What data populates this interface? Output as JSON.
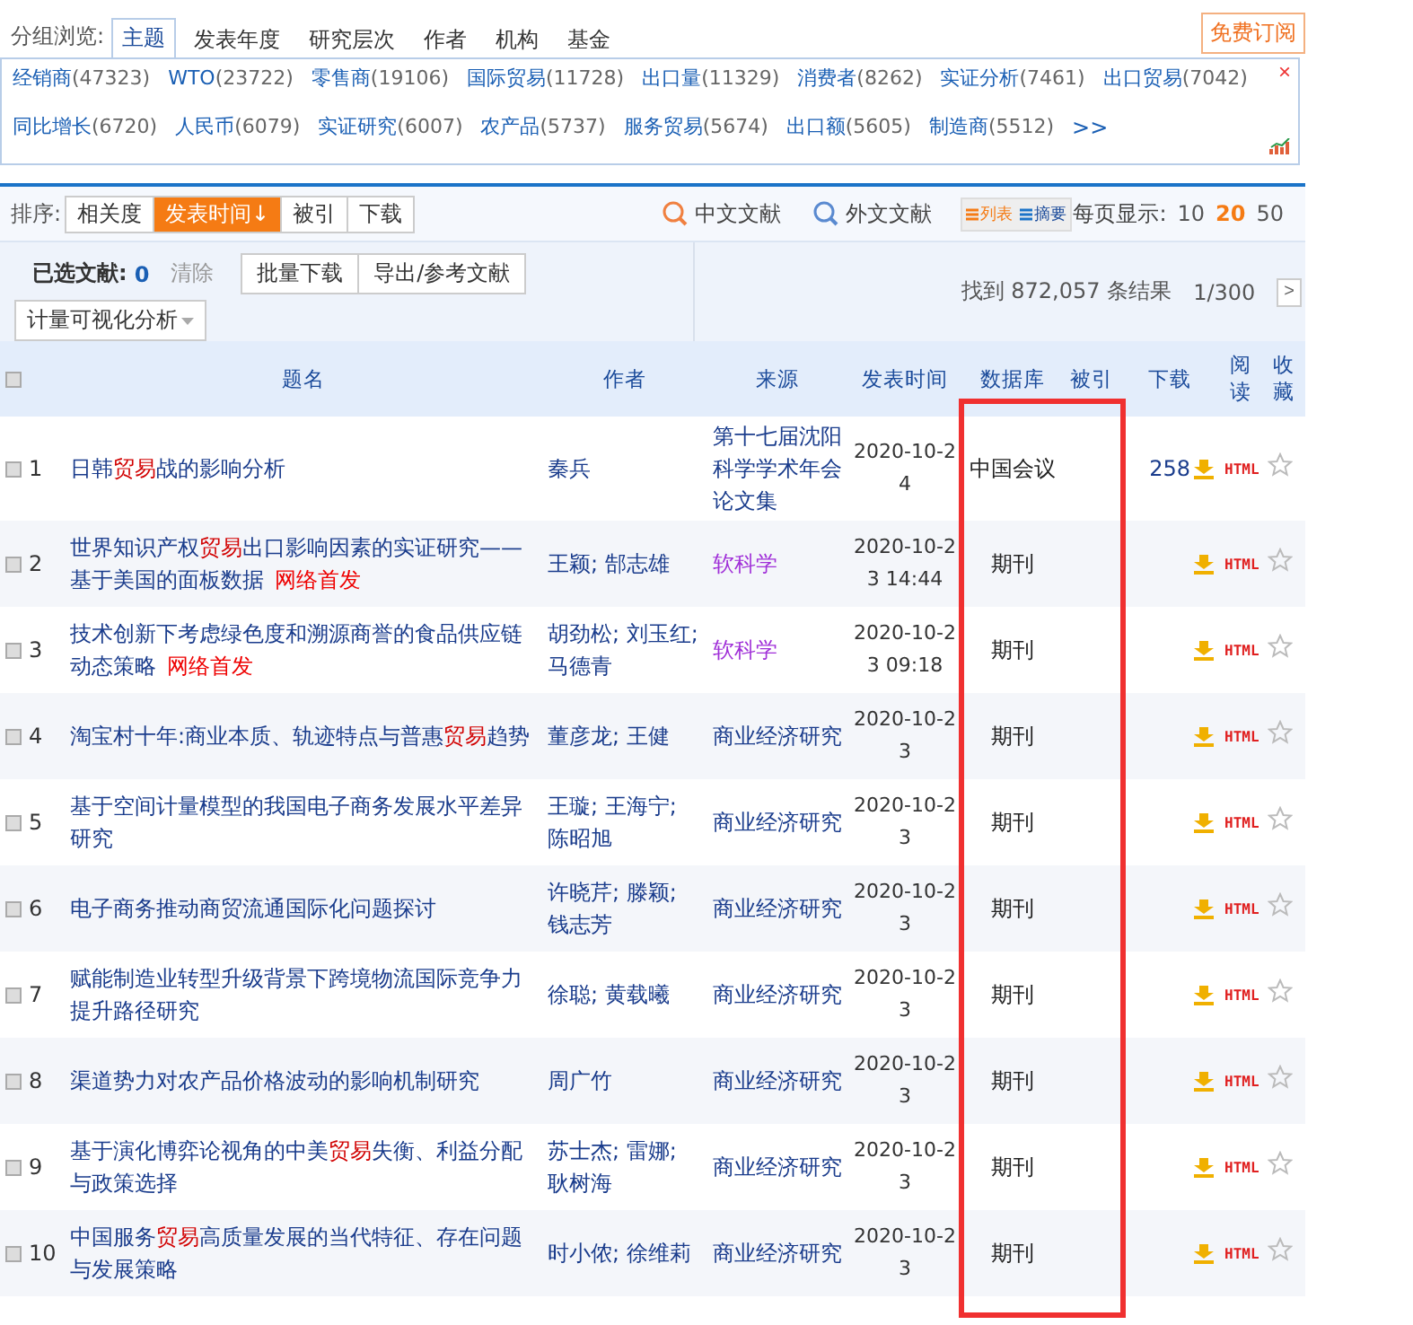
{
  "group_browse": {
    "label": "分组浏览:",
    "tabs": [
      {
        "label": "主题",
        "selected": true
      },
      {
        "label": "发表年度",
        "selected": false
      },
      {
        "label": "研究层次",
        "selected": false
      },
      {
        "label": "作者",
        "selected": false
      },
      {
        "label": "机构",
        "selected": false
      },
      {
        "label": "基金",
        "selected": false
      }
    ],
    "subscribe": "免费订阅",
    "close": "×",
    "keywords": [
      {
        "term": "经销商",
        "count": "(47323)"
      },
      {
        "term": "WTO",
        "count": "(23722)"
      },
      {
        "term": "零售商",
        "count": "(19106)"
      },
      {
        "term": "国际贸易",
        "count": "(11728)"
      },
      {
        "term": "出口量",
        "count": "(11329)"
      },
      {
        "term": "消费者",
        "count": "(8262)"
      },
      {
        "term": "实证分析",
        "count": "(7461)"
      },
      {
        "term": "出口贸易",
        "count": "(7042)"
      },
      {
        "term": "同比增长",
        "count": "(6720)"
      },
      {
        "term": "人民币",
        "count": "(6079)"
      },
      {
        "term": "实证研究",
        "count": "(6007)"
      },
      {
        "term": "农产品",
        "count": "(5737)"
      },
      {
        "term": "服务贸易",
        "count": "(5674)"
      },
      {
        "term": "出口额",
        "count": "(5605)"
      },
      {
        "term": "制造商",
        "count": "(5512)"
      }
    ],
    "more": ">>"
  },
  "sort_bar": {
    "label": "排序:",
    "options": [
      {
        "label": "相关度",
        "selected": false
      },
      {
        "label": "发表时间↓",
        "selected": true
      },
      {
        "label": "被引",
        "selected": false
      },
      {
        "label": "下载",
        "selected": false
      }
    ],
    "sources": [
      "中文文献",
      "外文文献"
    ],
    "views": [
      {
        "label": "列表",
        "selected": true
      },
      {
        "label": "摘要",
        "selected": false
      }
    ],
    "per_page_label": "每页显示:",
    "per_page": [
      {
        "label": "10",
        "selected": false
      },
      {
        "label": "20",
        "selected": true
      },
      {
        "label": "50",
        "selected": false
      }
    ]
  },
  "selection_bar": {
    "label": "已选文献:",
    "count": "0",
    "clear": "清除",
    "buttons": [
      "批量下载",
      "导出/参考文献"
    ],
    "analysis": "计量可视化分析",
    "found": "找到 872,057 条结果",
    "pages": "1/300",
    "next": ">"
  },
  "table": {
    "select_all_checked": false,
    "columns": [
      "题名",
      "作者",
      "来源",
      "发表时间",
      "数据库",
      "被引",
      "下载",
      "阅读",
      "收藏"
    ],
    "rows": [
      {
        "num": "1",
        "checked": false,
        "title": "日韩**贸易**战的影响分析",
        "authors": "秦兵",
        "source": "第十七届沈阳科学学术年会论文集",
        "visited": false,
        "date": "2020-10-24",
        "database": "中国会议",
        "downloads": "258",
        "read": "HTML"
      },
      {
        "num": "2",
        "checked": false,
        "title": "世界知识产权**贸易**出口影响因素的实证研究——基于美国的面板数据",
        "badge": "网络首发",
        "authors": "王颖; 郜志雄",
        "source": "软科学",
        "visited": true,
        "date": "2020-10-23 14:44",
        "database": "期刊",
        "read": "HTML"
      },
      {
        "num": "3",
        "checked": false,
        "title": "技术创新下考虑绿色度和溯源商誉的食品供应链动态策略",
        "badge": "网络首发",
        "authors": "胡劲松; 刘玉红; 马德青",
        "source": "软科学",
        "visited": true,
        "date": "2020-10-23 09:18",
        "database": "期刊",
        "read": "HTML"
      },
      {
        "num": "4",
        "checked": false,
        "title": "淘宝村十年:商业本质、轨迹特点与普惠**贸易**趋势",
        "authors": "董彦龙; 王健",
        "source": "商业经济研究",
        "visited": false,
        "date": "2020-10-23",
        "database": "期刊",
        "read": "HTML"
      },
      {
        "num": "5",
        "checked": false,
        "title": "基于空间计量模型的我国电子商务发展水平差异研究",
        "authors": "王璇; 王海宁; 陈昭旭",
        "source": "商业经济研究",
        "visited": false,
        "date": "2020-10-23",
        "database": "期刊",
        "read": "HTML"
      },
      {
        "num": "6",
        "checked": false,
        "title": "电子商务推动商贸流通国际化问题探讨",
        "authors": "许晓芹; 滕颖; 钱志芳",
        "source": "商业经济研究",
        "visited": false,
        "date": "2020-10-23",
        "database": "期刊",
        "read": "HTML"
      },
      {
        "num": "7",
        "checked": false,
        "title": "赋能制造业转型升级背景下跨境物流国际竞争力提升路径研究",
        "authors": "徐聪; 黄载曦",
        "source": "商业经济研究",
        "visited": false,
        "date": "2020-10-23",
        "database": "期刊",
        "read": "HTML"
      },
      {
        "num": "8",
        "checked": false,
        "title": "渠道势力对农产品价格波动的影响机制研究",
        "authors": "周广竹",
        "source": "商业经济研究",
        "visited": false,
        "date": "2020-10-23",
        "database": "期刊",
        "read": "HTML"
      },
      {
        "num": "9",
        "checked": false,
        "title": "基于演化博弈论视角的中美**贸易**失衡、利益分配与政策选择",
        "authors": "苏士杰; 雷娜; 耿树海",
        "source": "商业经济研究",
        "visited": false,
        "date": "2020-10-23",
        "database": "期刊",
        "read": "HTML"
      },
      {
        "num": "10",
        "checked": false,
        "title": "中国服务**贸易**高质量发展的当代特征、存在问题与发展策略",
        "authors": "时小侬; 徐维莉",
        "source": "商业经济研究",
        "visited": false,
        "date": "2020-10-23",
        "database": "期刊",
        "read": "HTML"
      }
    ]
  }
}
